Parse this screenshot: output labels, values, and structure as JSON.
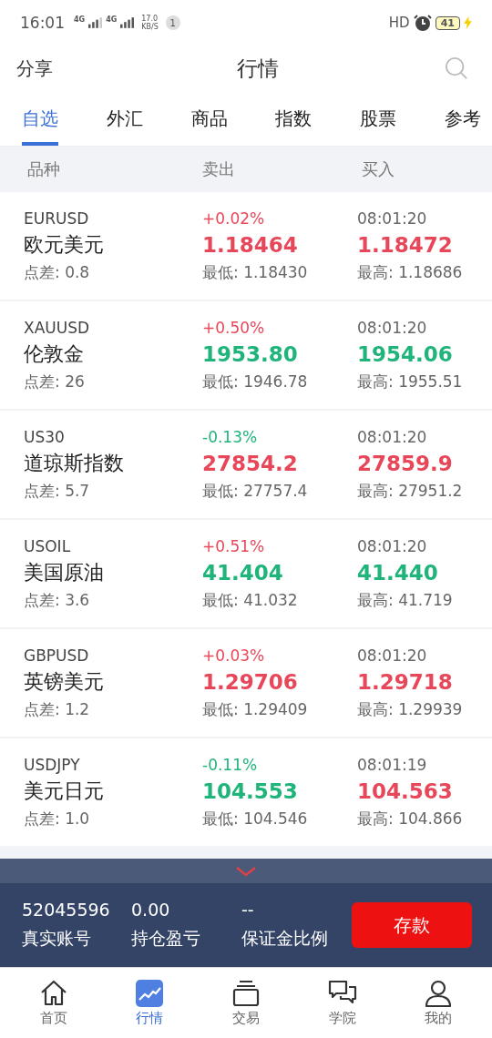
{
  "status_bar": {
    "time": "16:01",
    "net_1": "4G",
    "net_2": "4G",
    "speed": "17.0",
    "speed_unit": "KB/S",
    "notification_count": "1",
    "hd": "HD",
    "battery": "41"
  },
  "header": {
    "left": "分享",
    "title": "行情"
  },
  "tabs": [
    {
      "label": "自选",
      "selected": true
    },
    {
      "label": "外汇",
      "selected": false
    },
    {
      "label": "商品",
      "selected": false
    },
    {
      "label": "指数",
      "selected": false
    },
    {
      "label": "股票",
      "selected": false
    },
    {
      "label": "参考",
      "selected": false
    }
  ],
  "table": {
    "columns": [
      "品种",
      "卖出",
      "买入"
    ],
    "rows": [
      {
        "symbol": "EURUSD",
        "name": "欧元美元",
        "spread": "点差: 0.8",
        "change": "+0.02%",
        "change_up": true,
        "sell": "1.18464",
        "sell_up": true,
        "buy": "1.18472",
        "buy_up": true,
        "time": "08:01:20",
        "low": "最低: 1.18430",
        "high": "最高: 1.18686"
      },
      {
        "symbol": "XAUUSD",
        "name": "伦敦金",
        "spread": "点差: 26",
        "change": "+0.50%",
        "change_up": true,
        "sell": "1953.80",
        "sell_up": false,
        "buy": "1954.06",
        "buy_up": false,
        "time": "08:01:20",
        "low": "最低: 1946.78",
        "high": "最高: 1955.51"
      },
      {
        "symbol": "US30",
        "name": "道琼斯指数",
        "spread": "点差: 5.7",
        "change": "-0.13%",
        "change_up": false,
        "sell": "27854.2",
        "sell_up": true,
        "buy": "27859.9",
        "buy_up": true,
        "time": "08:01:20",
        "low": "最低: 27757.4",
        "high": "最高: 27951.2"
      },
      {
        "symbol": "USOIL",
        "name": "美国原油",
        "spread": "点差: 3.6",
        "change": "+0.51%",
        "change_up": true,
        "sell": "41.404",
        "sell_up": false,
        "buy": "41.440",
        "buy_up": false,
        "time": "08:01:20",
        "low": "最低: 41.032",
        "high": "最高: 41.719"
      },
      {
        "symbol": "GBPUSD",
        "name": "英镑美元",
        "spread": "点差: 1.2",
        "change": "+0.03%",
        "change_up": true,
        "sell": "1.29706",
        "sell_up": true,
        "buy": "1.29718",
        "buy_up": true,
        "time": "08:01:20",
        "low": "最低: 1.29409",
        "high": "最高: 1.29939"
      },
      {
        "symbol": "USDJPY",
        "name": "美元日元",
        "spread": "点差: 1.0",
        "change": "-0.11%",
        "change_up": false,
        "sell": "104.553",
        "sell_up": false,
        "buy": "104.563",
        "buy_up": true,
        "time": "08:01:19",
        "low": "最低: 104.546",
        "high": "最高: 104.866"
      }
    ]
  },
  "account": {
    "stats": [
      {
        "value": "52045596",
        "label": "真实账号"
      },
      {
        "value": "0.00",
        "label": "持仓盈亏"
      },
      {
        "value": "--",
        "label": "保证金比例"
      }
    ],
    "deposit_button": "存款"
  },
  "bottom_nav": [
    {
      "label": "首页",
      "selected": false,
      "kind": "home"
    },
    {
      "label": "行情",
      "selected": true,
      "kind": "chart"
    },
    {
      "label": "交易",
      "selected": false,
      "kind": "stack"
    },
    {
      "label": "学院",
      "selected": false,
      "kind": "chat"
    },
    {
      "label": "我的",
      "selected": false,
      "kind": "person"
    }
  ]
}
